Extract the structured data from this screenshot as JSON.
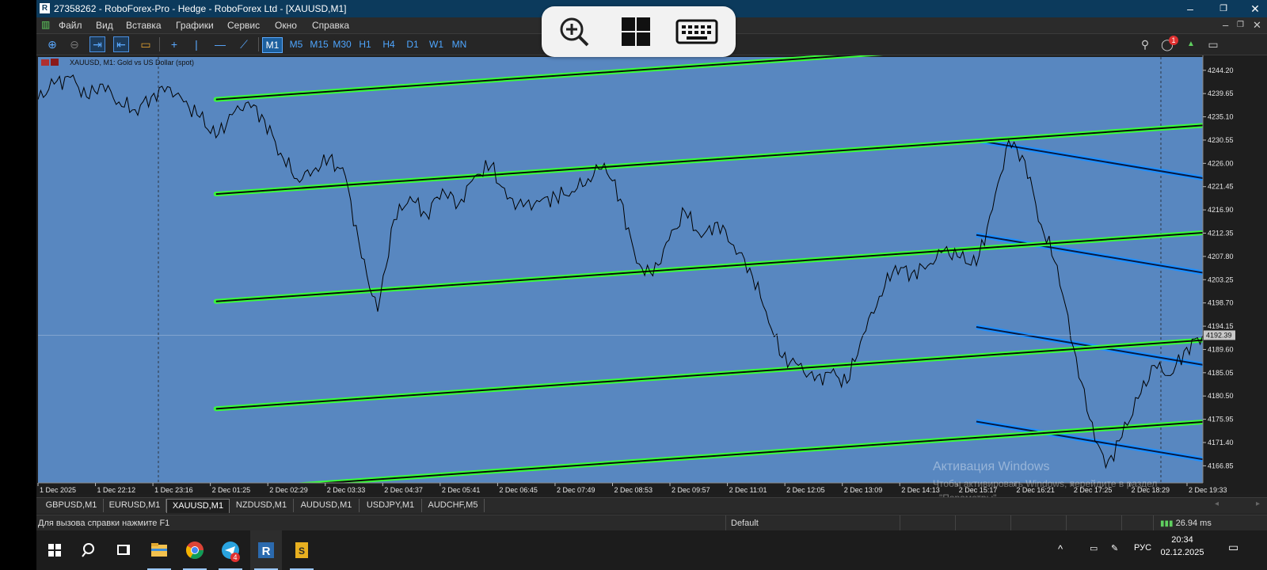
{
  "window": {
    "title": "27358262 - RoboForex-Pro - Hedge - RoboForex Ltd - [XAUUSD,M1]",
    "app_icon": "mt5-logo-icon",
    "controls": [
      "minimize",
      "restore",
      "close"
    ]
  },
  "menu": {
    "items": [
      "Файл",
      "Вид",
      "Вставка",
      "Графики",
      "Сервис",
      "Окно",
      "Справка"
    ]
  },
  "toolbar": {
    "timeframes": [
      "M1",
      "M5",
      "M15",
      "M30",
      "H1",
      "H4",
      "D1",
      "W1",
      "MN"
    ],
    "active_timeframe": "M1",
    "notification_count": "1",
    "icons": [
      "zoom-in-icon",
      "zoom-out-icon",
      "autoscroll-icon",
      "chart-shift-icon",
      "folder-icon",
      "crosshair-icon",
      "vertical-line-icon",
      "horizontal-line-icon",
      "trendline-icon",
      "search-icon",
      "notifications-icon",
      "levels-icon",
      "new-window-icon"
    ]
  },
  "overlay": {
    "buttons": [
      "zoom-icon",
      "windows-start-icon",
      "keyboard-icon"
    ]
  },
  "chart": {
    "header_label": "XAUUSD, M1:  Gold vs US Dollar (spot)",
    "current_price": "4192.39",
    "background_color": "#5887c0",
    "up_channel_color": "#39ff39",
    "down_channel_color": "#1e90ff"
  },
  "chart_data": {
    "type": "line",
    "title": "XAUUSD, M1:  Gold vs US Dollar (spot)",
    "y_ticks": [
      "4244.20",
      "4239.65",
      "4235.10",
      "4230.55",
      "4226.00",
      "4221.45",
      "4216.90",
      "4212.35",
      "4207.80",
      "4203.25",
      "4198.70",
      "4194.15",
      "4189.60",
      "4185.05",
      "4180.50",
      "4175.95",
      "4171.40",
      "4166.85"
    ],
    "x_ticks": [
      "1 Dec 2025",
      "1 Dec 22:12",
      "1 Dec 23:16",
      "2 Dec 01:25",
      "2 Dec 02:29",
      "2 Dec 03:33",
      "2 Dec 04:37",
      "2 Dec 05:41",
      "2 Dec 06:45",
      "2 Dec 07:49",
      "2 Dec 08:53",
      "2 Dec 09:57",
      "2 Dec 11:01",
      "2 Dec 12:05",
      "2 Dec 13:09",
      "2 Dec 14:13",
      "2 Dec 15:17",
      "2 Dec 16:21",
      "2 Dec 17:25",
      "2 Dec 18:29",
      "2 Dec 19:33"
    ],
    "ylim": [
      4163.5,
      4246.8
    ],
    "series": [
      {
        "values": [
          4238.5,
          4241.5,
          4242.8,
          4239.0,
          4241.5,
          4238.0,
          4236.5,
          4239.0,
          4241.0,
          4238.0,
          4235.0,
          4231.0,
          4235.5,
          4238.0,
          4234.5,
          4228.0,
          4223.0,
          4224.5,
          4227.0,
          4223.5,
          4207.5,
          4197.0,
          4215.0,
          4219.5,
          4216.0,
          4221.0,
          4218.0,
          4223.5,
          4225.5,
          4219.0,
          4217.5,
          4218.5,
          4219.5,
          4220.5,
          4223.0,
          4226.0,
          4219.0,
          4206.5,
          4204.0,
          4211.0,
          4216.5,
          4211.5,
          4214.5,
          4210.0,
          4205.5,
          4197.0,
          4188.0,
          4186.5,
          4183.5,
          4185.0,
          4183.0,
          4192.5,
          4200.0,
          4206.0,
          4204.5,
          4206.0,
          4209.0,
          4207.5,
          4206.0,
          4217.0,
          4230.5,
          4226.5,
          4214.0,
          4206.0,
          4190.0,
          4176.0,
          4166.5,
          4172.5,
          4180.0,
          4186.5,
          4184.5,
          4190.0,
          4192.5
        ]
      }
    ],
    "channels": {
      "up_levels_at_start": [
        4238.5,
        4220.0,
        4199.0,
        4178.0,
        4162.0
      ],
      "up_slope_per_bar": 0.22,
      "down_levels_at_start": [
        4230.5,
        4212.0,
        4194.0,
        4175.5,
        4163.0
      ],
      "down_slope_per_bar": -0.54
    }
  },
  "tabs": [
    "GBPUSD,M1",
    "EURUSD,M1",
    "XAUUSD,M1",
    "NZDUSD,M1",
    "AUDUSD,M1",
    "USDJPY,M1",
    "AUDCHF,M5"
  ],
  "active_tab": "XAUUSD,M1",
  "status": {
    "help_text": "Для вызова справки нажмите F1",
    "profile": "Default",
    "ping": "26.94 ms"
  },
  "watermark": {
    "title": "Активация Windows",
    "subtitle": "Чтобы активировать Windows, перейдите в раздел",
    "subtitle2": "\"Параметры\"."
  },
  "taskbar": {
    "language": "РУС",
    "time": "20:34",
    "date": "02.12.2025",
    "telegram_badge": "4",
    "icons": [
      "windows-start-icon",
      "search-icon",
      "task-view-icon",
      "file-explorer-icon",
      "chrome-icon",
      "telegram-icon",
      "roboforex-icon",
      "trading-app-icon"
    ]
  }
}
